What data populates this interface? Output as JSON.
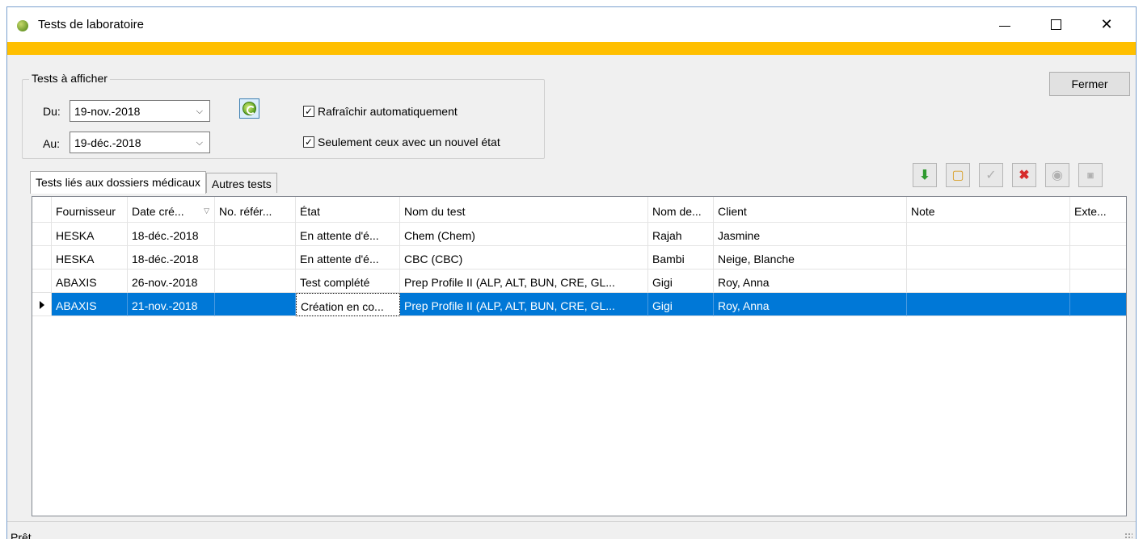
{
  "window": {
    "title": "Tests de laboratoire",
    "controls": {
      "minimize_icon": "minimize-icon",
      "maximize_icon": "maximize-icon",
      "close_glyph": "✕"
    }
  },
  "filters": {
    "group_label": "Tests à afficher",
    "from_label": "Du:",
    "from_value": "19-nov.-2018",
    "to_label": "Au:",
    "to_value": "19-déc.-2018",
    "auto_refresh_label": "Rafraîchir automatiquement",
    "auto_refresh_checked": true,
    "new_state_only_label": "Seulement ceux avec un nouvel état",
    "new_state_only_checked": true,
    "refresh_icon": "refresh-icon"
  },
  "close_button_label": "Fermer",
  "tabs": [
    {
      "label": "Tests liés aux dossiers médicaux",
      "active": true
    },
    {
      "label": "Autres tests",
      "active": false
    }
  ],
  "toolbar": [
    {
      "icon": "download-icon",
      "enabled": true
    },
    {
      "icon": "open-folder-icon",
      "enabled": true
    },
    {
      "icon": "approve-icon",
      "enabled": false
    },
    {
      "icon": "delete-icon",
      "enabled": true
    },
    {
      "icon": "web-view-icon",
      "enabled": false
    },
    {
      "icon": "pdf-icon",
      "enabled": false
    }
  ],
  "grid": {
    "columns": [
      "Fournisseur",
      "Date cré...",
      "No. référ...",
      "État",
      "Nom du test",
      "Nom de...",
      "Client",
      "Note",
      "Exte..."
    ],
    "sorted_column": "Date cré...",
    "sort_icon": "sort-descending-icon",
    "rows": [
      [
        "HESKA",
        "18-déc.-2018",
        "",
        "En attente d'é...",
        "Chem (Chem)",
        "Rajah",
        "Jasmine",
        "",
        ""
      ],
      [
        "HESKA",
        "18-déc.-2018",
        "",
        "En attente d'é...",
        "CBC (CBC)",
        "Bambi",
        "Neige, Blanche",
        "",
        ""
      ],
      [
        "ABAXIS",
        "26-nov.-2018",
        "",
        "Test complété",
        "Prep Profile II (ALP, ALT, BUN, CRE, GL...",
        "Gigi",
        "Roy, Anna",
        "",
        ""
      ],
      [
        "ABAXIS",
        "21-nov.-2018",
        "",
        "Création en co...",
        "Prep Profile II (ALP, ALT, BUN, CRE, GL...",
        "Gigi",
        "Roy, Anna",
        "",
        ""
      ]
    ],
    "selected_row": 3
  },
  "status": {
    "text": "Prêt"
  },
  "colors": {
    "accent_bar": "#ffbf00",
    "selection": "#0078d7"
  }
}
